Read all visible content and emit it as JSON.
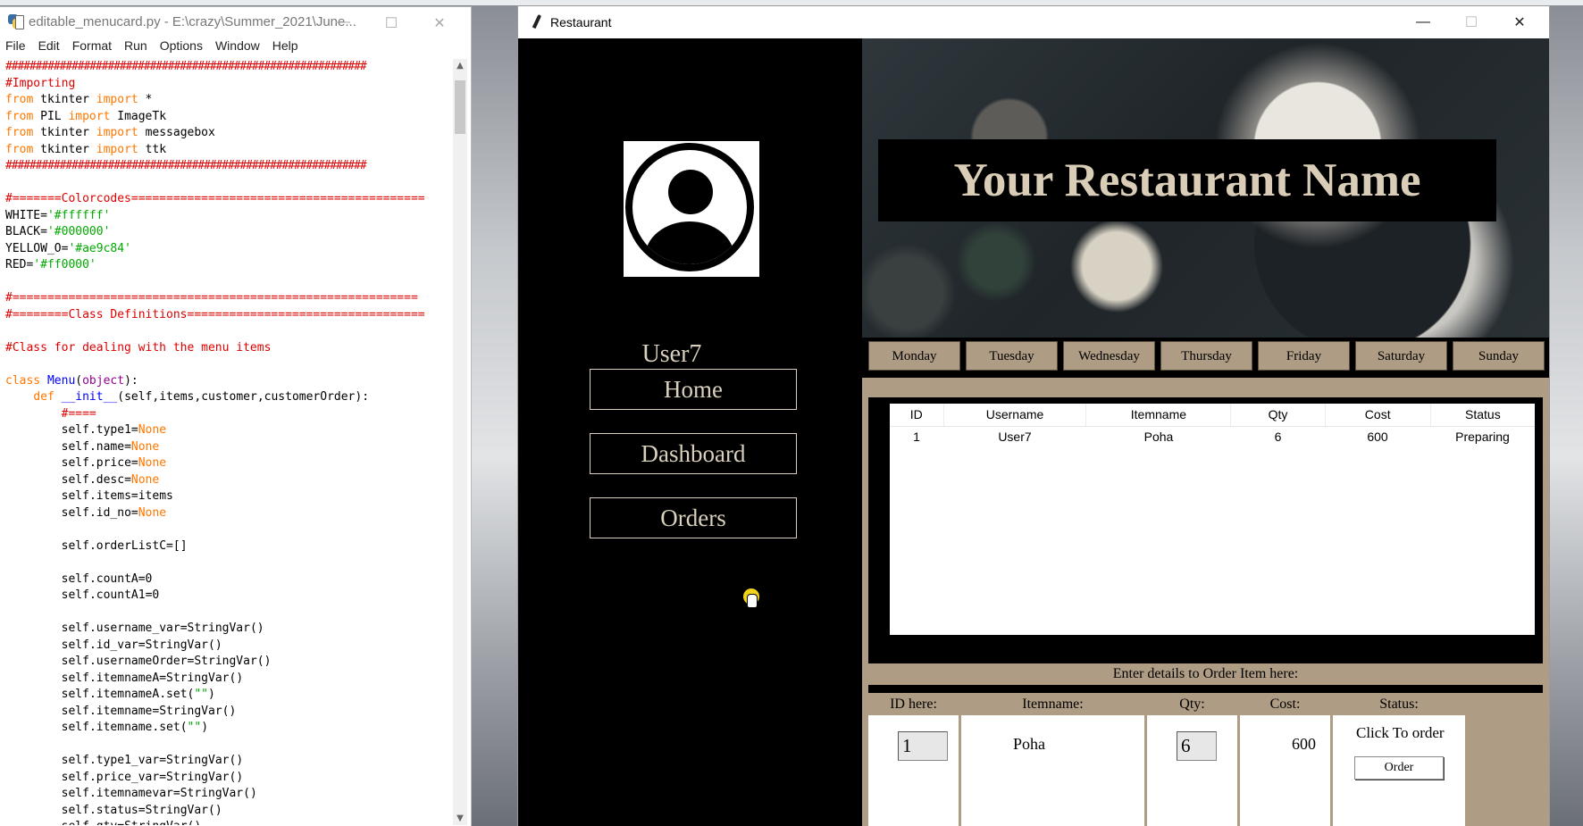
{
  "editor": {
    "title": "editable_menucard.py - E:\\crazy\\Summer_2021\\June...",
    "controls": {
      "min": "—",
      "max": "☐",
      "close": "✕"
    },
    "menu": [
      "File",
      "Edit",
      "Format",
      "Run",
      "Options",
      "Window",
      "Help"
    ],
    "code_lines": [
      "############################################################",
      "#Importing",
      "from tkinter import *",
      "from PIL import ImageTk",
      "from tkinter import messagebox",
      "from tkinter import ttk",
      "############################################################",
      "",
      "#=======Colorcodes==========================================",
      "WHITE='#ffffff'",
      "BLACK='#000000'",
      "YELLOW_O='#ae9c84'",
      "RED='#ff0000'",
      "",
      "#==========================================================",
      "#========Class Definitions==================================",
      "",
      "#Class for dealing with the menu items",
      "",
      "class Menu(object):",
      "    def __init__(self,items,customer,customerOrder):",
      "        #====",
      "        self.type1=None",
      "        self.name=None",
      "        self.price=None",
      "        self.desc=None",
      "        self.items=items",
      "        self.id_no=None",
      "",
      "        self.orderListC=[]",
      "",
      "        self.countA=0",
      "        self.countA1=0",
      "",
      "        self.username_var=StringVar()",
      "        self.id_var=StringVar()",
      "        self.usernameOrder=StringVar()",
      "        self.itemnameA=StringVar()",
      "        self.itemnameA.set(\"\")",
      "        self.itemname=StringVar()",
      "        self.itemname.set(\"\")",
      "",
      "        self.type1_var=StringVar()",
      "        self.price_var=StringVar()",
      "        self.itemnamevar=StringVar()",
      "        self.status=StringVar()",
      "        self.qty=StringVar()"
    ]
  },
  "restaurant": {
    "window_title": "Restaurant",
    "controls": {
      "min": "—",
      "max": "☐",
      "close": "✕"
    },
    "username": "User7",
    "nav": {
      "home": "Home",
      "dashboard": "Dashboard",
      "orders": "Orders"
    },
    "banner": "Your Restaurant Name",
    "days": [
      "Monday",
      "Tuesday",
      "Wednesday",
      "Thursday",
      "Friday",
      "Saturday",
      "Sunday"
    ],
    "table": {
      "headers": [
        "ID",
        "Username",
        "Itemname",
        "Qty",
        "Cost",
        "Status"
      ],
      "rows": [
        [
          "1",
          "User7",
          "Poha",
          "6",
          "600",
          "Preparing"
        ]
      ]
    },
    "entry": {
      "title": "Enter details to Order Item here:",
      "headers": {
        "id": "ID here:",
        "itemname": "Itemname:",
        "qty": "Qty:",
        "cost": "Cost:",
        "status": "Status:"
      },
      "id_value": "1",
      "itemname_value": "Poha",
      "qty_value": "6",
      "cost_value": "600",
      "status_text": "Click To order",
      "order_button": "Order"
    },
    "colors": {
      "accent": "#ae9c84",
      "background": "#000000",
      "text_light": "#d9d0bd"
    }
  }
}
